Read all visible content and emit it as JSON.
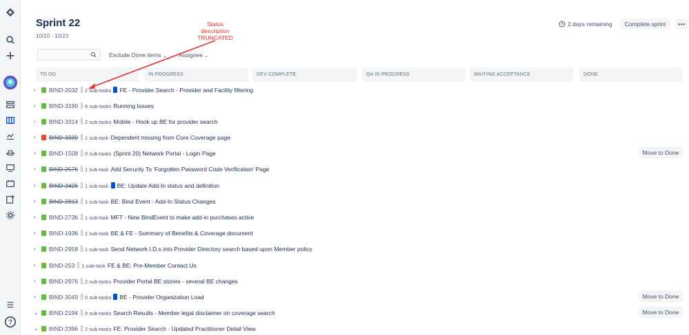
{
  "sidebar": {
    "icons": [
      "jira-logo-icon",
      "search-icon",
      "create-icon",
      "project-avatar-icon",
      "backlog-icon",
      "board-icon",
      "reports-icon",
      "releases-icon",
      "components-icon",
      "issues-icon",
      "add-item-icon",
      "settings-icon",
      "menu-icon",
      "help-icon"
    ]
  },
  "header": {
    "title": "Sprint 22",
    "dates": "10/10 - 10/23",
    "remaining": "2 days remaining",
    "complete_label": "Complete sprint",
    "more_label": "•••"
  },
  "filters": {
    "search_placeholder": "",
    "exclude_label": "Exclude Done items",
    "assignee_label": "Assignee"
  },
  "columns": [
    "TO DO",
    "IN PROGRESS",
    "DEV COMPLETE",
    "QA IN PROGRESS",
    "WAITING ACCEPTANCE",
    "DONE"
  ],
  "annotation": {
    "line1": "Status",
    "line2": "description",
    "line3": "TRUNCATED"
  },
  "rows": [
    {
      "key": "BIND-2032",
      "done": false,
      "bug": false,
      "subs": "2 sub-tasks",
      "tag": true,
      "summary": "FE - Provider Search - Provider and Facility filtering",
      "move": "",
      "chev": "›"
    },
    {
      "key": "BIND-3190",
      "done": false,
      "bug": false,
      "subs": "6 sub-tasks",
      "tag": false,
      "summary": "Running Issues",
      "move": "",
      "chev": "›"
    },
    {
      "key": "BIND-3314",
      "done": false,
      "bug": false,
      "subs": "2 sub-tasks",
      "tag": false,
      "summary": "Mobile - Hook up BE for provider search",
      "move": "",
      "chev": "›"
    },
    {
      "key": "BIND-3339",
      "done": true,
      "bug": true,
      "subs": "1 sub-task",
      "tag": false,
      "summary": "Dependent missing from Core Coverage page",
      "move": "",
      "chev": "›"
    },
    {
      "key": "BIND-1508",
      "done": false,
      "bug": false,
      "subs": "0 sub-tasks",
      "tag": false,
      "summary": "(Sprint 20) Network Portal - Login Page",
      "move": "Move to Done",
      "chev": "›"
    },
    {
      "key": "BIND-2576",
      "done": true,
      "bug": false,
      "subs": "1 sub-task",
      "tag": false,
      "summary": "Add Security To 'Forgotten Password Code Verification' Page",
      "move": "",
      "chev": "›"
    },
    {
      "key": "BIND-2426",
      "done": true,
      "bug": false,
      "subs": "1 sub-task",
      "tag": true,
      "summary": "BE: Update Add-In status and definition",
      "move": "",
      "chev": "›"
    },
    {
      "key": "BIND-2813",
      "done": true,
      "bug": false,
      "subs": "1 sub-task",
      "tag": false,
      "summary": "BE: Bind Event - Add-In Status Changes",
      "move": "",
      "chev": "›"
    },
    {
      "key": "BIND-2736",
      "done": false,
      "bug": false,
      "subs": "1 sub-task",
      "tag": false,
      "summary": "MFT - New BindEvent to make add-in purchases active",
      "move": "",
      "chev": "›"
    },
    {
      "key": "BIND-1936",
      "done": false,
      "bug": false,
      "subs": "1 sub-task",
      "tag": false,
      "summary": "BE & FE - Summary of Benefits & Coverage document",
      "move": "",
      "chev": "›"
    },
    {
      "key": "BIND-2958",
      "done": false,
      "bug": false,
      "subs": "1 sub-task",
      "tag": false,
      "summary": "Send Network I.D.s into Provider Directory search based upon Member policy",
      "move": "",
      "chev": "›"
    },
    {
      "key": "BIND-253",
      "done": false,
      "bug": false,
      "subs": "1 sub-task",
      "tag": false,
      "summary": "FE & BE: Pre-Member Contact Us",
      "move": "",
      "chev": "›"
    },
    {
      "key": "BIND-2976",
      "done": false,
      "bug": false,
      "subs": "2 sub-tasks",
      "tag": false,
      "summary": "Provider Portal BE stories - several BE changes",
      "move": "",
      "chev": "›"
    },
    {
      "key": "BIND-3049",
      "done": false,
      "bug": false,
      "subs": "0 sub-tasks",
      "tag": true,
      "summary": "BE - Provider Organization Load",
      "move": "Move to Done",
      "chev": "›"
    },
    {
      "key": "BIND-2194",
      "done": false,
      "bug": false,
      "subs": "0 sub-tasks",
      "tag": false,
      "summary": "Search Results - Member legal disclaimer on coverage search",
      "move": "Move to Done",
      "chev": "⌄"
    },
    {
      "key": "BIND-2396",
      "done": false,
      "bug": false,
      "subs": "2 sub-tasks",
      "tag": false,
      "summary": "FE: Provider Search - Updated Practitioner Detail View",
      "move": "",
      "chev": "⌄"
    }
  ],
  "colors": {
    "story": "#63ba3c",
    "bug": "#e5493a",
    "tag": "#0052cc",
    "annotation": "#e5302b"
  }
}
